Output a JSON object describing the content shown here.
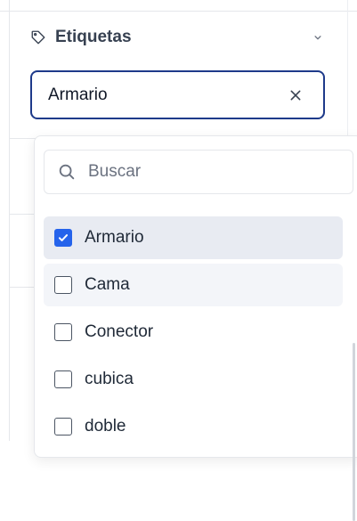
{
  "section": {
    "title": "Etiquetas",
    "icon": "tag-icon",
    "toggle_icon": "chevron-down-icon"
  },
  "selected": {
    "value": "Armario",
    "clear_icon": "close-icon"
  },
  "dropdown": {
    "search_placeholder": "Buscar",
    "search_value": "",
    "options": [
      {
        "label": "Armario",
        "checked": true
      },
      {
        "label": "Cama",
        "checked": false
      },
      {
        "label": "Conector",
        "checked": false
      },
      {
        "label": "cubica",
        "checked": false
      },
      {
        "label": "doble",
        "checked": false
      }
    ]
  },
  "colors": {
    "accent": "#2563eb",
    "input_border": "#1e3a8a",
    "selected_row": "#e8ebf2",
    "hover_row": "#f3f5f9"
  }
}
